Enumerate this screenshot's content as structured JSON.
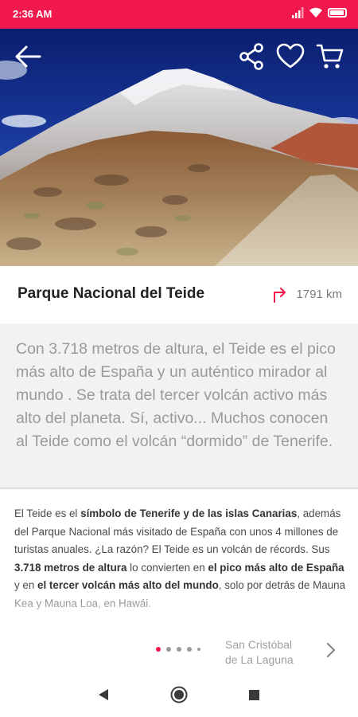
{
  "status_bar": {
    "time": "2:36 AM",
    "accent_color": "#f0184c"
  },
  "hero": {
    "icons": [
      "back-arrow-icon",
      "share-icon",
      "heart-icon",
      "cart-icon"
    ]
  },
  "place": {
    "title": "Parque Nacional del Teide",
    "distance": "1791 km",
    "distance_icon": "turn-right-arrow-icon"
  },
  "intro": {
    "text": "Con 3.718 metros de altura, el Teide es el pico más alto de España y un auténtico mirador al mundo . Se trata del tercer volcán activo más alto del planeta. Sí, activo... Muchos conocen al Teide como el volcán “dormido” de Tenerife."
  },
  "body": {
    "t1": "El Teide es el ",
    "b1": "símbolo de Tenerife y de las islas Canarias",
    "t2": ", además del Parque Nacional más visitado de España con unos 4 millones de turistas anuales. ¿La razón? El Teide es un volcán de récords. Sus ",
    "b2": "3.718 metros de altura",
    "t3": " lo convierten en ",
    "b3": "el pico más alto de España",
    "t4": " y en ",
    "b4": "el tercer volcán más alto del mundo",
    "t5": ", solo por detrás de Mauna Kea y Mauna Loa, en Hawái."
  },
  "pager": {
    "next_line1": "San Cristóbal",
    "next_line2": "de La Laguna",
    "active_index": 0,
    "dot_count": 5
  }
}
